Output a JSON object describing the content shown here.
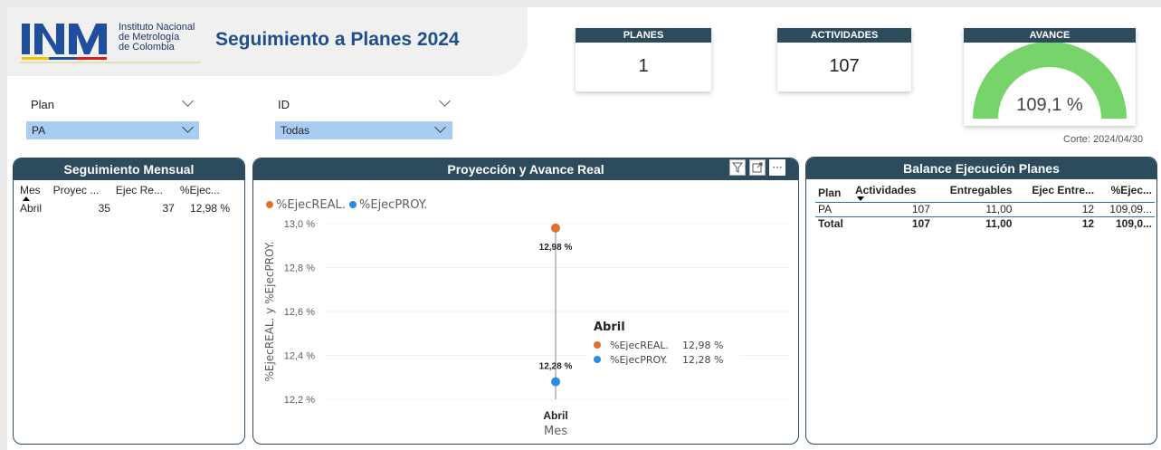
{
  "header": {
    "logo_letters": "INM",
    "org_lines": [
      "Instituto Nacional",
      "de Metrología",
      "de Colombia"
    ],
    "title": "Seguimiento a Planes  2024"
  },
  "kpis": {
    "planes": {
      "label": "PLANES",
      "value": "1"
    },
    "actividades": {
      "label": "ACTIVIDADES",
      "value": "107"
    },
    "avance": {
      "label": "AVANCE",
      "value": "109,1 %",
      "gauge_fill_fraction": 1.0,
      "color": "#77d46b"
    }
  },
  "slicers": {
    "plan": {
      "label": "Plan",
      "selected": "PA"
    },
    "id": {
      "label": "ID",
      "selected": "Todas"
    }
  },
  "corte": "Corte: 2024/04/30",
  "seguimiento": {
    "title": "Seguimiento Mensual",
    "columns": [
      "Mes",
      "Proyec ...",
      "Ejec Re...",
      "%Ejec..."
    ],
    "rows": [
      [
        "Abril",
        "35",
        "37",
        "12,98 %"
      ]
    ]
  },
  "proyeccion": {
    "title": "Proyección y Avance Real",
    "legend": [
      {
        "name": "%EjecREAL.",
        "color": "#e07030"
      },
      {
        "name": "%EjecPROY.",
        "color": "#2b8ae8"
      }
    ],
    "tooltip": {
      "title": "Abril",
      "rows": [
        {
          "name": "%EjecREAL.",
          "value": "12,98 %"
        },
        {
          "name": "%EjecPROY.",
          "value": "12,28 %"
        }
      ]
    },
    "toolbar_icons": [
      "filter-icon",
      "focus-mode-icon",
      "more-options-icon"
    ]
  },
  "balance": {
    "title": "Balance Ejecución Planes",
    "columns": [
      "Plan",
      "Actividades",
      "Entregables",
      "Ejec Entre...",
      "%Ejec..."
    ],
    "rows": [
      [
        "PA",
        "107",
        "11,00",
        "12",
        "109,09..."
      ]
    ],
    "total": [
      "Total",
      "107",
      "11,00",
      "12",
      "109,0..."
    ]
  },
  "chart_data": {
    "type": "line",
    "categories": [
      "Abril"
    ],
    "series": [
      {
        "name": "%EjecREAL.",
        "values": [
          12.98
        ],
        "label": "12,98 %"
      },
      {
        "name": "%EjecPROY.",
        "values": [
          12.28
        ],
        "label": "12,28 %"
      }
    ],
    "xlabel": "Mes",
    "ylabel": "%EjecREAL. y %EjecPROY.",
    "yticks": [
      "13,0 %",
      "12,8 %",
      "12,6 %",
      "12,4 %",
      "12,2 %"
    ],
    "ylim": [
      12.2,
      13.0
    ],
    "grid": true,
    "legend_position": "top-left"
  }
}
